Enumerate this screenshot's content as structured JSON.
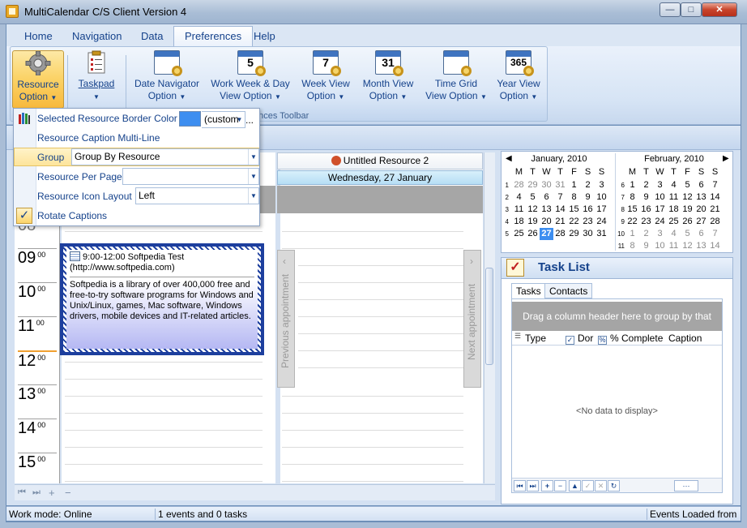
{
  "window": {
    "title": "MultiCalendar C/S Client Version 4",
    "min": "—",
    "max": "□",
    "close": "✕"
  },
  "menu_tabs": [
    "Home",
    "Navigation",
    "Data",
    "Preferences",
    "Help"
  ],
  "ribbon": {
    "group_label": "ences Toolbar",
    "buttons": [
      {
        "line1": "Resource",
        "line2": "Option"
      },
      {
        "line1": "Taskpad",
        "line2": ""
      },
      {
        "line1": "Date Navigator",
        "line2": "Option"
      },
      {
        "line1": "Work Week & Day",
        "line2": "View Option"
      },
      {
        "line1": "Week View",
        "line2": "Option"
      },
      {
        "line1": "Month View",
        "line2": "Option"
      },
      {
        "line1": "Time Grid",
        "line2": "View Option"
      },
      {
        "line1": "Year View",
        "line2": "Option"
      }
    ],
    "icon_numbers": [
      "5",
      "7",
      "31",
      "365"
    ]
  },
  "dropdown": {
    "border_color_label": "Selected Resource Border Color",
    "border_color_value": "(custom",
    "border_color_swatch": "#3d8ef0",
    "ellipsis": "...",
    "caption_multiline": "Resource Caption Multi-Line",
    "group_label": "Group",
    "group_value": "Group By Resource",
    "per_page_label": "Resource Per Page",
    "per_page_value": "",
    "icon_layout_label": "Resource Icon Layout",
    "icon_layout_value": "Left",
    "rotate_captions": "Rotate Captions"
  },
  "scheduler": {
    "resource_name": "Untitled Resource 2",
    "day_header": "Wednesday, 27 January",
    "hours": [
      {
        "h": "09",
        "m": "00"
      },
      {
        "h": "10",
        "m": "00"
      },
      {
        "h": "11",
        "m": "00"
      },
      {
        "h": "12",
        "m": "00"
      },
      {
        "h": "13",
        "m": "00"
      },
      {
        "h": "14",
        "m": "00"
      },
      {
        "h": "15",
        "m": "00"
      }
    ],
    "partial_hour": "08",
    "prev_label": "Previous appointment",
    "next_label": "Next appointment",
    "appointment": {
      "time_title": "9:00-12:00 Softpedia Test",
      "location": "(http://www.softpedia.com)",
      "body": "Softpedia is a library of over 400,000 free and free-to-try software programs for Windows and Unix/Linux, games, Mac software, Windows drivers, mobile devices and IT-related articles."
    },
    "bottom_icons": [
      "⏮",
      "⏭",
      "+",
      "−"
    ]
  },
  "calendars": {
    "dow": [
      "M",
      "T",
      "W",
      "T",
      "F",
      "S",
      "S"
    ],
    "jan": {
      "title": "January, 2010",
      "weeks": [
        "1",
        "2",
        "3",
        "4",
        "5"
      ],
      "rows": [
        [
          "28",
          "29",
          "30",
          "31",
          "1",
          "2",
          "3"
        ],
        [
          "4",
          "5",
          "6",
          "7",
          "8",
          "9",
          "10"
        ],
        [
          "11",
          "12",
          "13",
          "14",
          "15",
          "16",
          "17"
        ],
        [
          "18",
          "19",
          "20",
          "21",
          "22",
          "23",
          "24"
        ],
        [
          "25",
          "26",
          "27",
          "28",
          "29",
          "30",
          "31"
        ]
      ]
    },
    "feb": {
      "title": "February, 2010",
      "weeks": [
        "6",
        "7",
        "8",
        "9",
        "10",
        "11"
      ],
      "rows": [
        [
          "1",
          "2",
          "3",
          "4",
          "5",
          "6",
          "7"
        ],
        [
          "8",
          "9",
          "10",
          "11",
          "12",
          "13",
          "14"
        ],
        [
          "15",
          "16",
          "17",
          "18",
          "19",
          "20",
          "21"
        ],
        [
          "22",
          "23",
          "24",
          "25",
          "26",
          "27",
          "28"
        ],
        [
          "1",
          "2",
          "3",
          "4",
          "5",
          "6",
          "7"
        ],
        [
          "8",
          "9",
          "10",
          "11",
          "12",
          "13",
          "14"
        ]
      ]
    },
    "arrows": {
      "prev": "◀",
      "next": "▶"
    }
  },
  "tasks": {
    "title": "Task List",
    "tabs": [
      "Tasks",
      "Contacts"
    ],
    "group_hint": "Drag a column header here to group by that column",
    "columns": [
      "Type",
      "Dor",
      "% Complete",
      "Caption"
    ],
    "empty": "<No data to display>",
    "nav_buttons": [
      "⏮",
      "⏭",
      "+",
      "−",
      "▲",
      "✓",
      "✕",
      "↻",
      "···"
    ]
  },
  "status": {
    "mode": "Work mode: Online",
    "counts": "1 events and 0 tasks",
    "loaded": "Events Loaded from"
  },
  "colors": {
    "accent": "#15428b",
    "highlight": "#fbd46a",
    "today": "#3d8ef0"
  }
}
